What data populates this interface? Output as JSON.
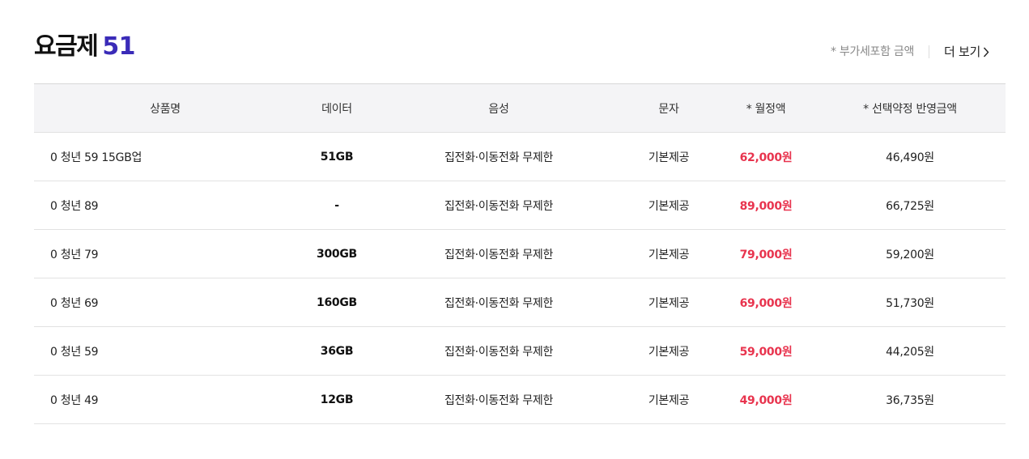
{
  "header": {
    "title": "요금제",
    "count": "51",
    "vat_note": "* 부가세포함 금액",
    "more_label": "더 보기"
  },
  "table": {
    "columns": [
      "상품명",
      "데이터",
      "음성",
      "문자",
      "* 월정액",
      "* 선택약정 반영금액"
    ],
    "rows": [
      {
        "name": "0 청년 59 15GB업",
        "data": "51GB",
        "voice": "집전화·이동전화 무제한",
        "sms": "기본제공",
        "monthly": "62,000원",
        "discounted": "46,490원"
      },
      {
        "name": "0 청년 89",
        "data": "-",
        "voice": "집전화·이동전화 무제한",
        "sms": "기본제공",
        "monthly": "89,000원",
        "discounted": "66,725원"
      },
      {
        "name": "0 청년 79",
        "data": "300GB",
        "voice": "집전화·이동전화 무제한",
        "sms": "기본제공",
        "monthly": "79,000원",
        "discounted": "59,200원"
      },
      {
        "name": "0 청년 69",
        "data": "160GB",
        "voice": "집전화·이동전화 무제한",
        "sms": "기본제공",
        "monthly": "69,000원",
        "discounted": "51,730원"
      },
      {
        "name": "0 청년 59",
        "data": "36GB",
        "voice": "집전화·이동전화 무제한",
        "sms": "기본제공",
        "monthly": "59,000원",
        "discounted": "44,205원"
      },
      {
        "name": "0 청년 49",
        "data": "12GB",
        "voice": "집전화·이동전화 무제한",
        "sms": "기본제공",
        "monthly": "49,000원",
        "discounted": "36,735원"
      }
    ]
  },
  "colors": {
    "accent_count": "#3a2bb8",
    "price": "#e8344e",
    "header_bg": "#f4f4f6"
  },
  "icons": {
    "more": "chevron-right-icon"
  }
}
